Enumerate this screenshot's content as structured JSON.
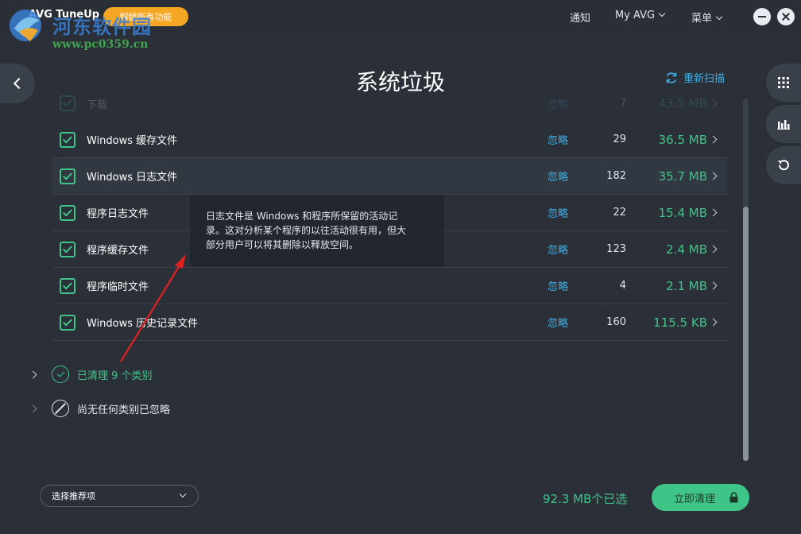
{
  "titlebar": {
    "app_name": "AVG TuneUp",
    "unlock_label": "解锁所有功能",
    "watermark_title": "河东软件园",
    "watermark_url": "www.pc0359.cn",
    "nav": {
      "notify": "通知",
      "myavg": "My AVG",
      "menu": "菜单"
    }
  },
  "page": {
    "title": "系统垃圾",
    "rescan_label": "重新扫描"
  },
  "rows": [
    {
      "name": "下载",
      "ignore": "忽略",
      "count": "7",
      "size": "43.5 MB"
    },
    {
      "name": "Windows 缓存文件",
      "ignore": "忽略",
      "count": "29",
      "size": "36.5 MB"
    },
    {
      "name": "Windows 日志文件",
      "ignore": "忽略",
      "count": "182",
      "size": "35.7 MB"
    },
    {
      "name": "程序日志文件",
      "ignore": "忽略",
      "count": "22",
      "size": "15.4 MB"
    },
    {
      "name": "程序缓存文件",
      "ignore": "忽略",
      "count": "123",
      "size": "2.4 MB"
    },
    {
      "name": "程序临时文件",
      "ignore": "忽略",
      "count": "4",
      "size": "2.1 MB"
    },
    {
      "name": "Windows 历史记录文件",
      "ignore": "忽略",
      "count": "160",
      "size": "115.5 KB"
    }
  ],
  "tooltip": {
    "line1": "日志文件是 Windows 和程序所保留的活动记",
    "line2": "录。这对分析某个程序的以往活动很有用，但大",
    "line3": "部分用户可以将其删除以释放空间。"
  },
  "summary": {
    "cleaned": "已清理 9 个类别",
    "ignored": "尚无任何类别已忽略"
  },
  "footer": {
    "recommend_label": "选择推荐项",
    "selected": "92.3 MB个已选",
    "clean_label": "立即清理"
  },
  "colors": {
    "background": "#2b3038",
    "accent_green": "#41c48a",
    "link_blue": "#3fb0e6",
    "unlock_orange": "#f5a623"
  }
}
